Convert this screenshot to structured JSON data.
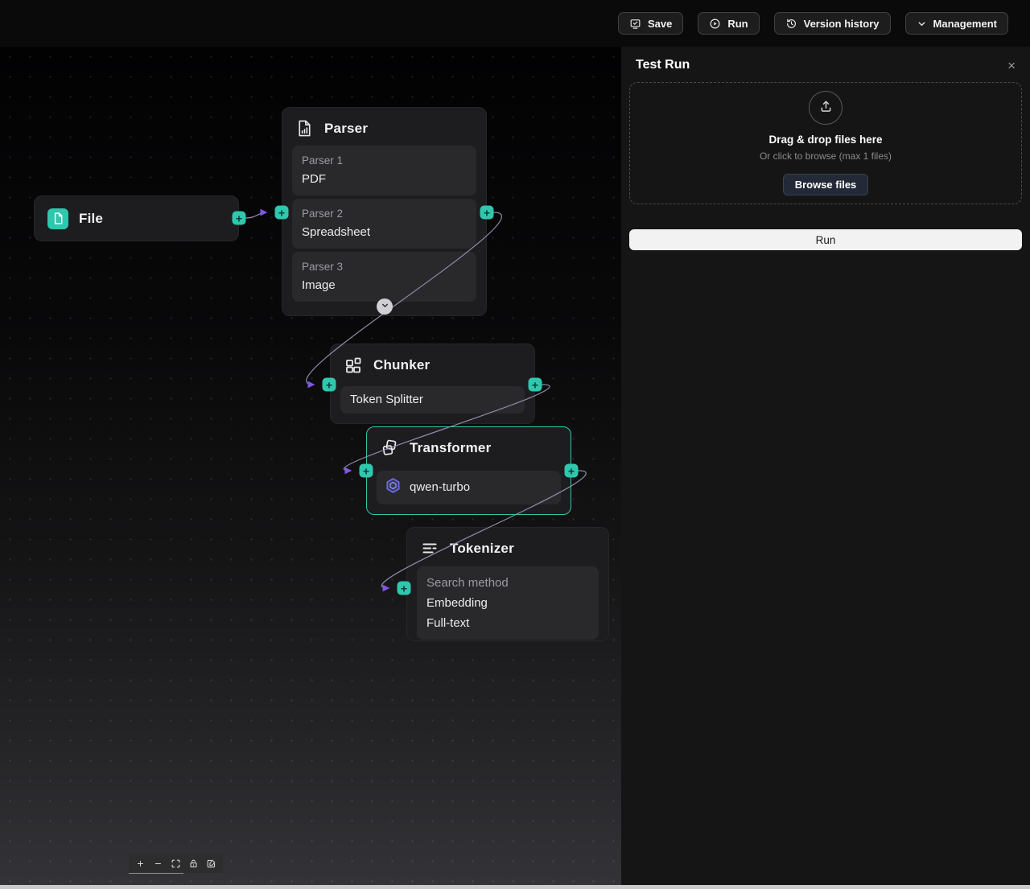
{
  "toolbar": {
    "save": "Save",
    "run": "Run",
    "version_history": "Version history",
    "management": "Management"
  },
  "glyphs": {
    "plus": "+",
    "minus": "−",
    "close": "×"
  },
  "nodes": {
    "file": {
      "title": "File"
    },
    "parser": {
      "title": "Parser",
      "items": [
        {
          "label": "Parser 1",
          "value": "PDF"
        },
        {
          "label": "Parser 2",
          "value": "Spreadsheet"
        },
        {
          "label": "Parser 3",
          "value": "Image"
        }
      ]
    },
    "chunker": {
      "title": "Chunker",
      "value": "Token Splitter"
    },
    "transformer": {
      "title": "Transformer",
      "model": "qwen-turbo"
    },
    "tokenizer": {
      "title": "Tokenizer",
      "label": "Search method",
      "methods": [
        "Embedding",
        "Full-text"
      ]
    }
  },
  "panel": {
    "title": "Test Run",
    "dropzone_heading": "Drag & drop files here",
    "dropzone_subtext": "Or click to browse (max 1 files)",
    "browse_label": "Browse files",
    "run_label": "Run"
  },
  "colors": {
    "accent": "#2fc7ad",
    "edge": "#9a95b5",
    "arrow": "#8b5cf6",
    "qwen": "#6d6af2"
  }
}
